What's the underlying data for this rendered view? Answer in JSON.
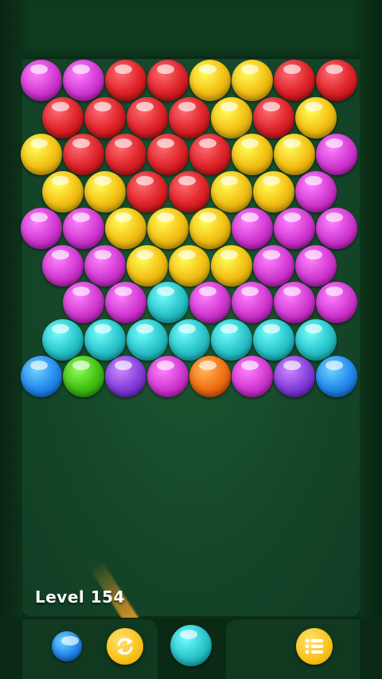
{
  "game": {
    "level_label": "Level 154"
  },
  "colors": {
    "magenta": "#d63fd6",
    "red": "#e1282e",
    "yellow": "#f6c417",
    "cyan": "#2fc9cf",
    "blue": "#2a8ff0",
    "green": "#49c416",
    "purple": "#8a45df",
    "orange": "#f27416",
    "button_gold": "#f9c41d"
  },
  "grid": {
    "rows": [
      [
        "magenta",
        "magenta",
        "red",
        "red",
        "yellow",
        "yellow",
        "red",
        "red"
      ],
      [
        "red",
        "red",
        "red",
        "red",
        "yellow",
        "red",
        "yellow"
      ],
      [
        "yellow",
        "red",
        "red",
        "red",
        "red",
        "yellow",
        "yellow",
        "magenta"
      ],
      [
        "yellow",
        "yellow",
        "red",
        "red",
        "yellow",
        "yellow",
        "magenta"
      ],
      [
        "magenta",
        "magenta",
        "yellow",
        "yellow",
        "yellow",
        "magenta",
        "magenta",
        "magenta"
      ],
      [
        "magenta",
        "magenta",
        "yellow",
        "yellow",
        "yellow",
        "magenta",
        "magenta"
      ],
      [
        null,
        "magenta",
        "magenta",
        "cyan",
        "magenta",
        "magenta",
        "magenta",
        "magenta"
      ],
      [
        "cyan",
        "cyan",
        "cyan",
        "cyan",
        "cyan",
        "cyan",
        "cyan"
      ],
      [
        "blue",
        "green",
        "purple",
        "magenta",
        "orange",
        "magenta",
        "purple",
        "blue"
      ]
    ]
  },
  "shooter": {
    "current_bubble": "cyan",
    "next_bubble": "blue"
  },
  "controls": {
    "swap_icon": "swap-arrows-icon",
    "menu_icon": "menu-list-icon"
  }
}
